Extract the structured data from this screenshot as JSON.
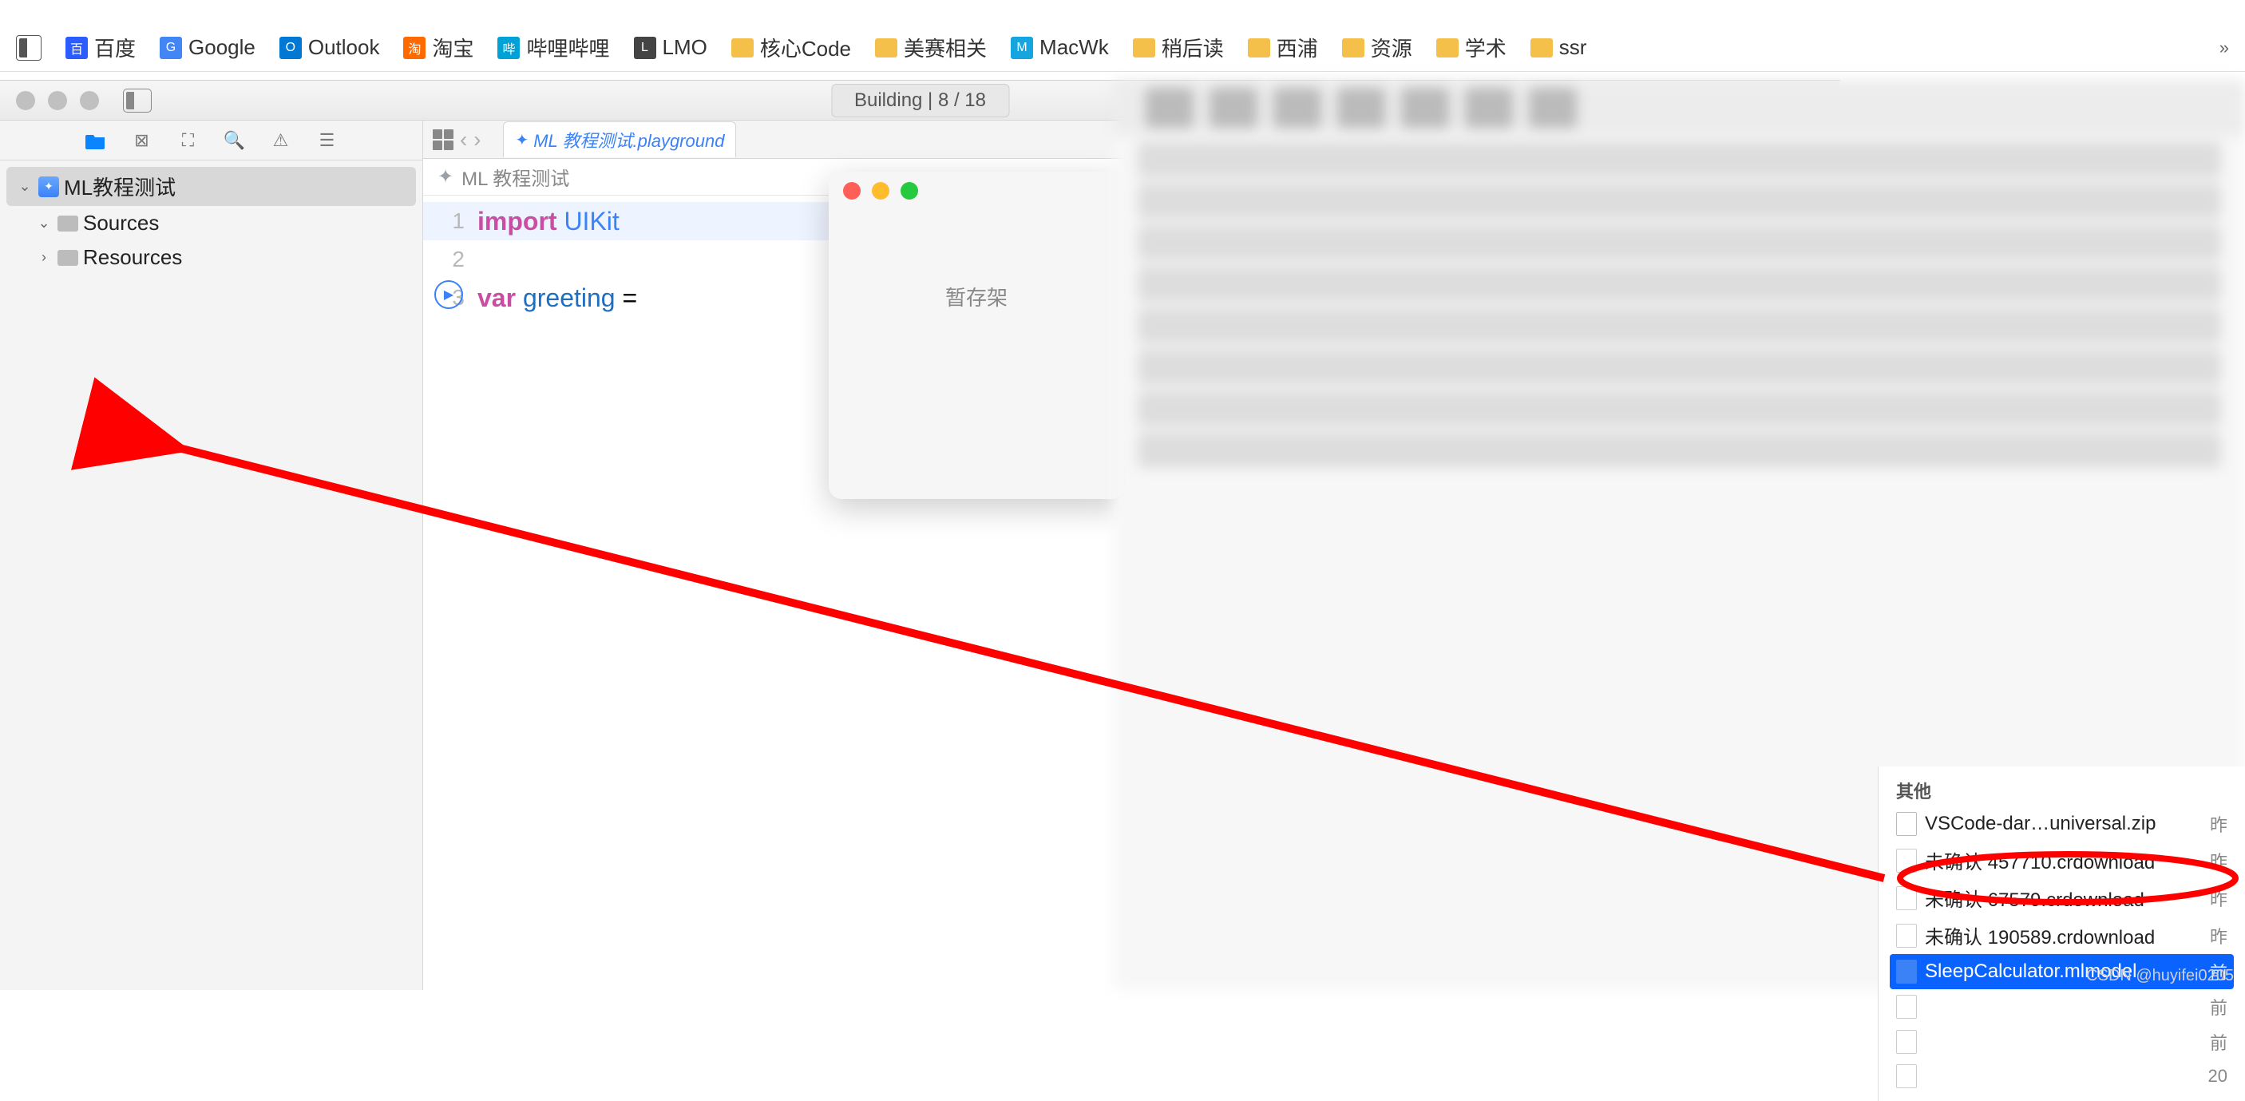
{
  "bookmarks": {
    "items": [
      {
        "label": "百度",
        "icon": "baidu"
      },
      {
        "label": "Google",
        "icon": "google"
      },
      {
        "label": "Outlook",
        "icon": "outlook"
      },
      {
        "label": "淘宝",
        "icon": "taobao"
      },
      {
        "label": "哔哩哔哩",
        "icon": "bilibili"
      },
      {
        "label": "LMO",
        "icon": "lmo"
      },
      {
        "label": "核心Code",
        "icon": "folder"
      },
      {
        "label": "美赛相关",
        "icon": "folder"
      },
      {
        "label": "MacWk",
        "icon": "macwk"
      },
      {
        "label": "稍后读",
        "icon": "folder"
      },
      {
        "label": "西浦",
        "icon": "folder"
      },
      {
        "label": "资源",
        "icon": "folder"
      },
      {
        "label": "学术",
        "icon": "folder"
      },
      {
        "label": "ssr",
        "icon": "folder"
      }
    ]
  },
  "xcode": {
    "status": "Building | 8 / 18",
    "navigator": {
      "root": "ML教程测试",
      "children": [
        {
          "label": "Sources"
        },
        {
          "label": "Resources"
        }
      ]
    },
    "tab": {
      "label": "ML 教程测试.playground"
    },
    "filepath": {
      "label": "ML 教程测试"
    },
    "code": {
      "lines": [
        {
          "n": "1",
          "segments": [
            {
              "t": "import",
              "c": "kw"
            },
            {
              "t": " "
            },
            {
              "t": "UIKit",
              "c": "type"
            }
          ],
          "hl": true
        },
        {
          "n": "2",
          "segments": []
        },
        {
          "n": "3",
          "segments": [
            {
              "t": "var",
              "c": "kw"
            },
            {
              "t": " "
            },
            {
              "t": "greeting",
              "c": "ident"
            },
            {
              "t": " = "
            }
          ]
        }
      ]
    }
  },
  "shelf": {
    "title": "暂存架"
  },
  "finder": {
    "section_heading": "其他",
    "rows": [
      {
        "name": "VSCode-dar…universal.zip",
        "time": "昨",
        "type": "zip"
      },
      {
        "name": "未确认 457710.crdownload",
        "time": "昨",
        "type": "file"
      },
      {
        "name": "未确认 67579.crdownload",
        "time": "昨",
        "type": "file"
      },
      {
        "name": "未确认 190589.crdownload",
        "time": "昨",
        "type": "file"
      },
      {
        "name": "SleepCalculator.mlmodel",
        "time": "前",
        "type": "mlmodel",
        "selected": true
      },
      {
        "name": "",
        "time": "前",
        "type": "file"
      },
      {
        "name": "",
        "time": "前",
        "type": "file"
      },
      {
        "name": "",
        "time": "20",
        "type": "file"
      }
    ]
  },
  "watermark": "CSDN @huyifei0205"
}
